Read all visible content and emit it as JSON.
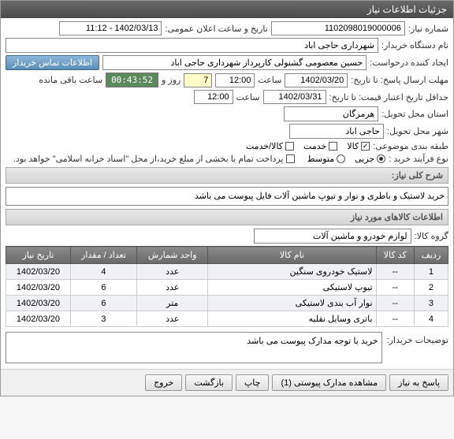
{
  "window": {
    "title": "جزئیات اطلاعات نیاز"
  },
  "header": {
    "need_no_label": "شماره نیاز:",
    "need_no": "1102098019000006",
    "ann_datetime_label": "تاریخ و ساعت اعلان عمومی:",
    "ann_datetime": "1402/03/13 - 11:12",
    "buyer_label": "نام دستگاه خریدار:",
    "buyer": "شهرداری حاجی اباد",
    "requester_label": "ایجاد کننده درخواست:",
    "requester": "حسین معصومی گشنولی کارپرداز شهرداری حاجی اباد",
    "contact_btn": "اطلاعات تماس خریدار",
    "deadline_label": "مهلت ارسال پاسخ: تا تاریخ:",
    "deadline_date": "1402/03/20",
    "time_label": "ساعت",
    "deadline_time": "12:00",
    "day_label": "روز و",
    "days": "7",
    "remain_label": "ساعت باقی مانده",
    "countdown": "00:43:52",
    "validity_label": "حداقل تاریخ اعتبار قیمت: تا تاریخ:",
    "validity_date": "1402/03/31",
    "validity_time": "12:00",
    "province_label": "استان محل تحویل:",
    "province": "هرمزگان",
    "city_label": "شهر محل تحویل:",
    "city": "حاجی اباد",
    "category_label": "طبقه بندی موضوعی:",
    "cat_goods": "کالا",
    "cat_service": "خدمت",
    "cat_goods_service": "کالا/خدمت",
    "process_label": "نوع فرآیند خرید :",
    "proc_partial": "جزیی",
    "proc_medium": "متوسط",
    "proc_note": "پرداخت تمام یا بخشی از مبلغ خرید،از محل \"اسناد خزانه اسلامی\" خواهد بود."
  },
  "summary": {
    "section": "شرح کلی نیاز:",
    "text": "خرید لاستیک و باطری و نوار و تیوپ ماشین آلات فایل پیوست می باشد"
  },
  "goods": {
    "section": "اطلاعات کالاهای مورد نیاز",
    "group_label": "گروه کالا:",
    "group": "لوازم خودرو و ماشین آلات",
    "cols": {
      "row": "ردیف",
      "code": "کد کالا",
      "name": "نام کالا",
      "unit": "واحد شمارش",
      "qty": "تعداد / مقدار",
      "date": "تاریخ نیاز"
    },
    "rows": [
      {
        "row": "1",
        "code": "--",
        "name": "لاستیک خودروی سنگین",
        "unit": "عدد",
        "qty": "4",
        "date": "1402/03/20"
      },
      {
        "row": "2",
        "code": "--",
        "name": "تیوپ لاستیکی",
        "unit": "عدد",
        "qty": "6",
        "date": "1402/03/20"
      },
      {
        "row": "3",
        "code": "--",
        "name": "نوار آب بندی لاستیکی",
        "unit": "متر",
        "qty": "6",
        "date": "1402/03/20"
      },
      {
        "row": "4",
        "code": "--",
        "name": "باتری وسایل نقلیه",
        "unit": "عدد",
        "qty": "3",
        "date": "1402/03/20"
      }
    ]
  },
  "buyer_notes": {
    "label": "توضیحات خریدار:",
    "text": "خرید با توجه مدارک پیوست می باشد"
  },
  "footer": {
    "reply": "پاسخ به نیاز",
    "attachments": "مشاهده مدارک پیوستی (1)",
    "print": "چاپ",
    "back": "بازگشت",
    "exit": "خروج"
  }
}
